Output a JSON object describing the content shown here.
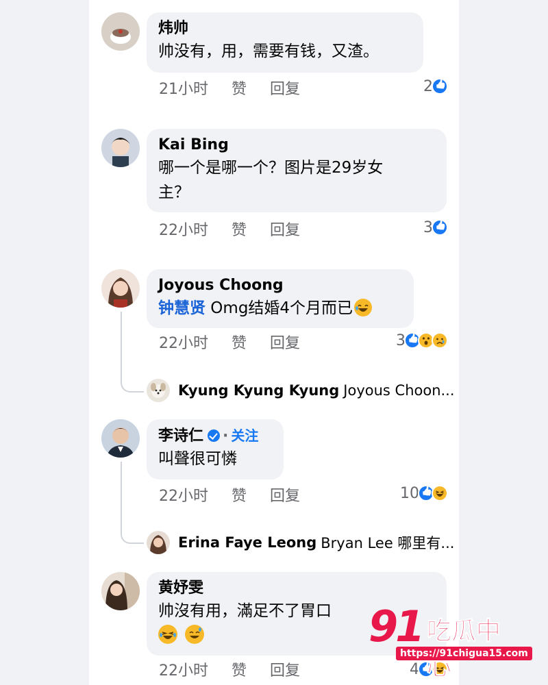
{
  "comments": [
    {
      "author": "炜帅",
      "text": "帅没有，用，需要有钱，又渣。",
      "time": "21小时",
      "like_label": "赞",
      "reply_label": "回复",
      "reaction_count": "2",
      "reactions": [
        "like-icon"
      ]
    },
    {
      "author": "Kai Bing",
      "text_line1": "哪一个是哪一个？图片是29岁女",
      "text_line2": "主？",
      "time": "22小时",
      "like_label": "赞",
      "reply_label": "回复",
      "reaction_count": "3",
      "reactions": [
        "like-icon"
      ]
    },
    {
      "author": "Joyous Choong",
      "mention": "钟慧贤",
      "text": " Omg结婚4个月而已",
      "time": "22小时",
      "like_label": "赞",
      "reply_label": "回复",
      "reaction_count": "3",
      "reactions": [
        "like-icon",
        "wow-icon",
        "sad-icon"
      ],
      "reply_preview": {
        "author": "Kyung Kyung Kyung",
        "text": "Joyous Choon..."
      }
    },
    {
      "author": "李诗仁",
      "verified": true,
      "follow_label": "关注",
      "text": "叫聲很可憐",
      "time": "22小时",
      "like_label": "赞",
      "reply_label": "回复",
      "reaction_count": "10",
      "reactions": [
        "like-icon",
        "haha-icon"
      ],
      "reply_preview": {
        "author": "Erina Faye Leong",
        "text": "Bryan Lee 哪里有..."
      }
    },
    {
      "author": "黄妤雯",
      "text_line1": "帅沒有用，滿足不了胃口",
      "time": "22小时",
      "like_label": "赞",
      "reply_label": "回复",
      "reaction_count": "4",
      "reactions": [
        "like-icon",
        "haha-icon"
      ]
    }
  ],
  "watermark": {
    "number": "91",
    "name": "吃瓜中心",
    "url": "https://91chigua15.com"
  },
  "colors": {
    "page_bg": "#f0f2f5",
    "bubble_bg": "#f0f2f5",
    "link_blue": "#1877f2",
    "meta_gray": "#65676b",
    "watermark_red": "#e8194a"
  }
}
